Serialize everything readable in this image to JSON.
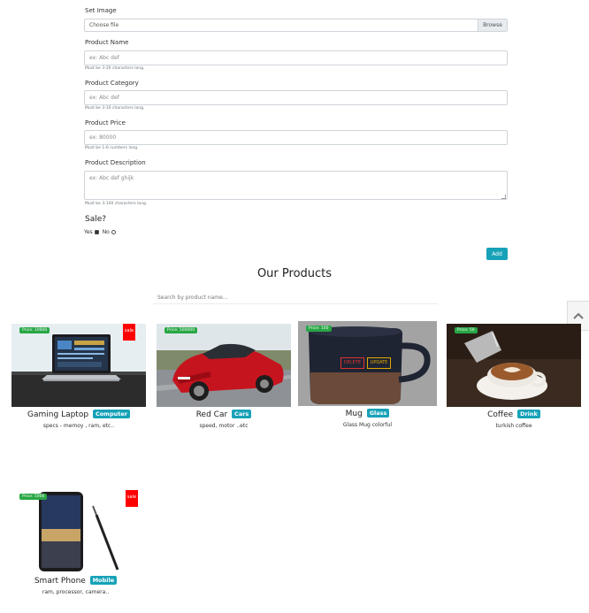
{
  "form": {
    "image_label": "Set Image",
    "file_placeholder": "Choose file",
    "browse_label": "Browse",
    "name_label": "Product Name",
    "name_placeholder": "ex: Abc def",
    "name_help": "Must be 3-20 characters long.",
    "category_label": "Product Category",
    "category_placeholder": "ex: Abc def",
    "category_help": "Must be 3-10 characters long.",
    "price_label": "Product Price",
    "price_placeholder": "ex: 80000",
    "price_help": "Must be 1-6 numbers long.",
    "description_label": "Product Description",
    "description_placeholder": "ex: Abc def ghijk",
    "description_help": "Must be 3-100 characters long.",
    "sale_question": "Sale?",
    "yes_label": "Yes",
    "no_label": "No",
    "sale_selected": "Yes",
    "add_button": "Add"
  },
  "products_section": {
    "title": "Our Products",
    "search_placeholder": "Search by product name..."
  },
  "products": [
    {
      "name": "Gaming Laptop",
      "category": "Computer",
      "price": "Price: 10000",
      "description": "specs - memoy , ram, etc..",
      "on_sale": true,
      "sale_label": "sale"
    },
    {
      "name": "Red Car",
      "category": "Cars",
      "price": "Price: 500000",
      "description": "speed, motor ..etc",
      "on_sale": false
    },
    {
      "name": "Mug",
      "category": "Glass",
      "price": "Price: 100",
      "description": "Glass Mug colorful",
      "on_sale": false,
      "overlay_buttons": {
        "delete": "DELETE",
        "update": "UPDATE"
      }
    },
    {
      "name": "Coffee",
      "category": "Drink",
      "price": "Price: 50",
      "description": "turkish coffee",
      "on_sale": false
    },
    {
      "name": "Smart Phone",
      "category": "Mobile",
      "price": "Price: 5000",
      "description": "ram, processor, camera..",
      "on_sale": true,
      "sale_label": "sale"
    }
  ],
  "icons": {
    "scroll_top": "chevron-up-icon"
  },
  "colors": {
    "accent": "#17a2b8",
    "price_badge": "#28a745",
    "sale_tag": "#ff0000"
  }
}
